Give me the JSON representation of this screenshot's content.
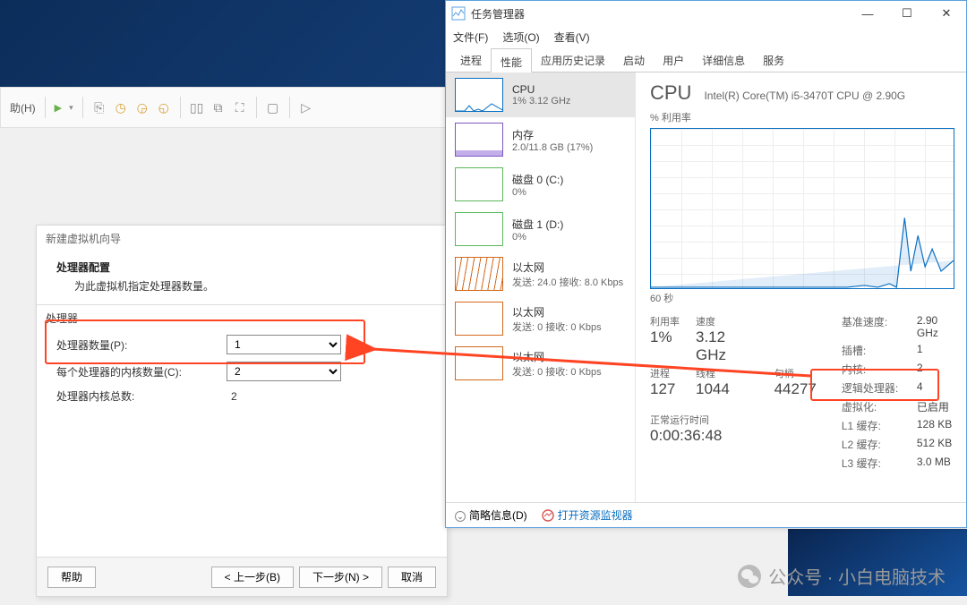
{
  "vmware": {
    "help_menu": "助(H)",
    "wizard": {
      "window_title": "新建虚拟机向导",
      "header": "处理器配置",
      "subheader": "为此虚拟机指定处理器数量。",
      "section": "处理器",
      "proc_count_label": "处理器数量(P):",
      "proc_count_value": "1",
      "cores_label": "每个处理器的内核数量(C):",
      "cores_value": "2",
      "total_label": "处理器内核总数:",
      "total_value": "2",
      "btn_help": "帮助",
      "btn_back": "< 上一步(B)",
      "btn_next": "下一步(N) >",
      "btn_cancel": "取消"
    }
  },
  "taskmgr": {
    "title": "任务管理器",
    "menu": {
      "file": "文件(F)",
      "options": "选项(O)",
      "view": "查看(V)"
    },
    "tabs": [
      "进程",
      "性能",
      "应用历史记录",
      "启动",
      "用户",
      "详细信息",
      "服务"
    ],
    "active_tab": "性能",
    "side": {
      "cpu": {
        "title": "CPU",
        "sub": "1% 3.12 GHz"
      },
      "mem": {
        "title": "内存",
        "sub": "2.0/11.8 GB (17%)"
      },
      "disk0": {
        "title": "磁盘 0 (C:)",
        "sub": "0%"
      },
      "disk1": {
        "title": "磁盘 1 (D:)",
        "sub": "0%"
      },
      "eth0": {
        "title": "以太网",
        "sub": "发送: 24.0 接收: 8.0 Kbps"
      },
      "eth1": {
        "title": "以太网",
        "sub": "发送: 0 接收: 0 Kbps"
      },
      "eth2": {
        "title": "以太网",
        "sub": "发送: 0 接收: 0 Kbps"
      }
    },
    "main": {
      "heading": "CPU",
      "model": "Intel(R) Core(TM) i5-3470T CPU @ 2.90G",
      "util_label": "% 利用率",
      "xaxis": "60 秒",
      "stats": {
        "util_l": "利用率",
        "util_v": "1%",
        "speed_l": "速度",
        "speed_v": "3.12 GHz",
        "proc_l": "进程",
        "proc_v": "127",
        "thread_l": "线程",
        "thread_v": "1044",
        "handle_l": "句柄",
        "handle_v": "44277",
        "uptime_l": "正常运行时间",
        "uptime_v": "0:00:36:48"
      },
      "kv": {
        "base_l": "基准速度:",
        "base_v": "2.90 GHz",
        "sockets_l": "插槽:",
        "sockets_v": "1",
        "cores_l": "内核:",
        "cores_v": "2",
        "logical_l": "逻辑处理器:",
        "logical_v": "4",
        "virt_l": "虚拟化:",
        "virt_v": "已启用",
        "l1_l": "L1 缓存:",
        "l1_v": "128 KB",
        "l2_l": "L2 缓存:",
        "l2_v": "512 KB",
        "l3_l": "L3 缓存:",
        "l3_v": "3.0 MB"
      }
    },
    "footer": {
      "brief": "简略信息(D)",
      "resmon": "打开资源监视器"
    }
  },
  "watermark": "公众号 · 小白电脑技术"
}
